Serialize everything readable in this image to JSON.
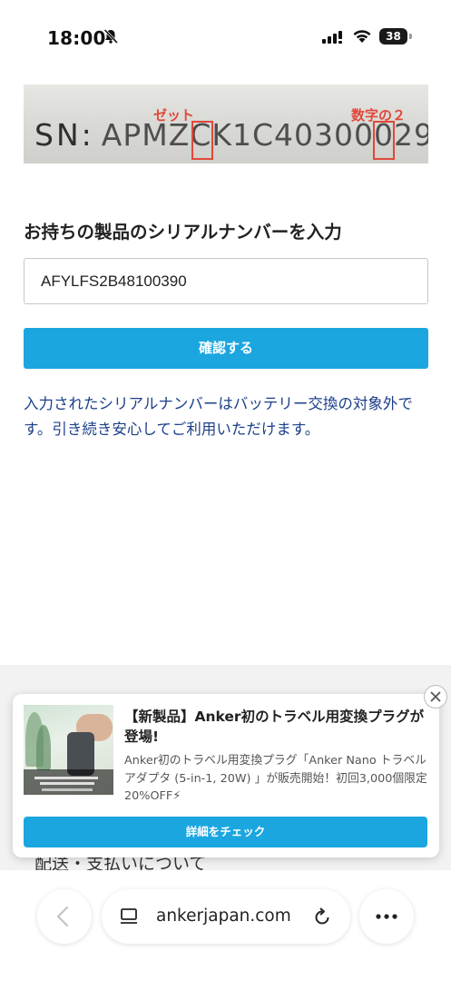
{
  "status_bar": {
    "time": "18:00",
    "battery_level": "38",
    "icons": [
      "bell-slash-icon",
      "signal-icon",
      "wifi-icon",
      "battery-icon"
    ]
  },
  "serial_example": {
    "prefix": "SN:",
    "serial": "APMZCK1C40300029",
    "label_zero": "ゼット",
    "label_two": "数字の２"
  },
  "form": {
    "heading": "お持ちの製品のシリアルナンバーを入力",
    "serial_value": "AFYLFS2B48100390",
    "confirm_label": "確認する",
    "result_message": "入力されたシリアルナンバーはバッテリー交換の対象外です。引き続き安心してご利用いただけます。"
  },
  "behind_text": "配送・支払いについて",
  "promo": {
    "title": "【新製品】Anker初のトラベル用変換プラグが登場!",
    "description": "Anker初のトラベル用変換プラグ「Anker Nano トラベルアダプタ (5-in-1, 20W) 」が販売開始！初回3,000個限定20%OFF⚡",
    "button_label": "詳細をチェック"
  },
  "browser": {
    "url": "ankerjapan.com"
  },
  "colors": {
    "accent_blue": "#1ba6e0",
    "message_text": "#1c3f8a",
    "annotation_red": "#e0483a"
  }
}
